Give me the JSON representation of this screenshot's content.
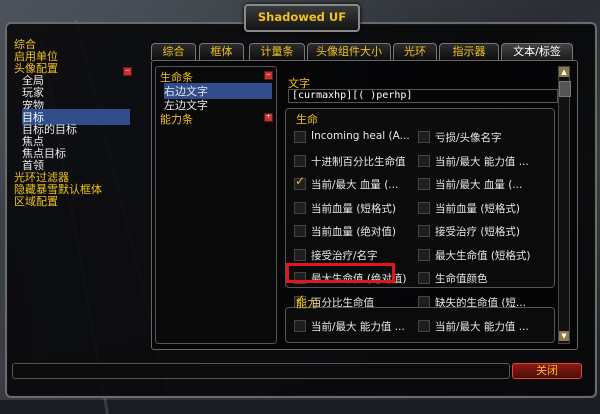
{
  "window": {
    "title": "Shadowed UF"
  },
  "nav": {
    "items": [
      {
        "label": "综合",
        "level": 0
      },
      {
        "label": "启用单位",
        "level": 0
      },
      {
        "label": "头像配置",
        "level": 0
      },
      {
        "label": "全局",
        "level": 1
      },
      {
        "label": "玩家",
        "level": 1
      },
      {
        "label": "宠物",
        "level": 1
      },
      {
        "label": "目标",
        "level": 1,
        "selected": true
      },
      {
        "label": "目标的目标",
        "level": 1
      },
      {
        "label": "焦点",
        "level": 1
      },
      {
        "label": "焦点目标",
        "level": 1
      },
      {
        "label": "首领",
        "level": 1
      },
      {
        "label": "光环过滤器",
        "level": 0
      },
      {
        "label": "隐藏暴雪默认框体",
        "level": 0
      },
      {
        "label": "区域配置",
        "level": 0
      }
    ]
  },
  "tabs": [
    {
      "label": "综合"
    },
    {
      "label": "框体"
    },
    {
      "label": "计量条"
    },
    {
      "label": "头像组件大小"
    },
    {
      "label": "光环"
    },
    {
      "label": "指示器"
    },
    {
      "label": "文本/标签",
      "active": true
    }
  ],
  "subtree": {
    "health_bar": "生命条",
    "right_text": "右边文字",
    "left_text": "左边文字",
    "power_bar": "能力条"
  },
  "text_section": {
    "label": "文字",
    "value": "[curmaxhp][( )perhp]"
  },
  "health_group": {
    "label": "生命",
    "options": [
      {
        "label": "Incoming heal (A...",
        "checked": false
      },
      {
        "label": "亏损/头像名字",
        "checked": false
      },
      {
        "label": "十进制百分比生命值",
        "checked": false
      },
      {
        "label": "当前/最大 能力值 ...",
        "checked": false
      },
      {
        "label": "当前/最大 血量 (...",
        "checked": true
      },
      {
        "label": "当前/最大 血量 (...",
        "checked": false
      },
      {
        "label": "当前血量 (短格式)",
        "checked": false
      },
      {
        "label": "当前血量 (短格式)",
        "checked": false
      },
      {
        "label": "当前血量 (绝对值)",
        "checked": false
      },
      {
        "label": "接受治疗 (短格式)",
        "checked": false
      },
      {
        "label": "接受治疗/名字",
        "checked": false
      },
      {
        "label": "最大生命值 (短格式)",
        "checked": false
      },
      {
        "label": "最大生命值 (绝对值)",
        "checked": false
      },
      {
        "label": "生命值颜色",
        "checked": false
      },
      {
        "label": "百分比生命值",
        "checked": true
      },
      {
        "label": "缺失的生命值 (短...",
        "checked": false
      }
    ]
  },
  "power_group": {
    "label": "能力",
    "options": [
      {
        "label": "当前/最大 能力值 ...",
        "checked": false
      },
      {
        "label": "当前/最大 能力值 ...",
        "checked": false
      }
    ]
  },
  "footer": {
    "close_label": "关闭"
  },
  "icons": {
    "collapse": "collapse-icon",
    "expand": "expand-icon",
    "scroll_up": "arrow-up-icon",
    "scroll_down": "arrow-down-icon"
  }
}
